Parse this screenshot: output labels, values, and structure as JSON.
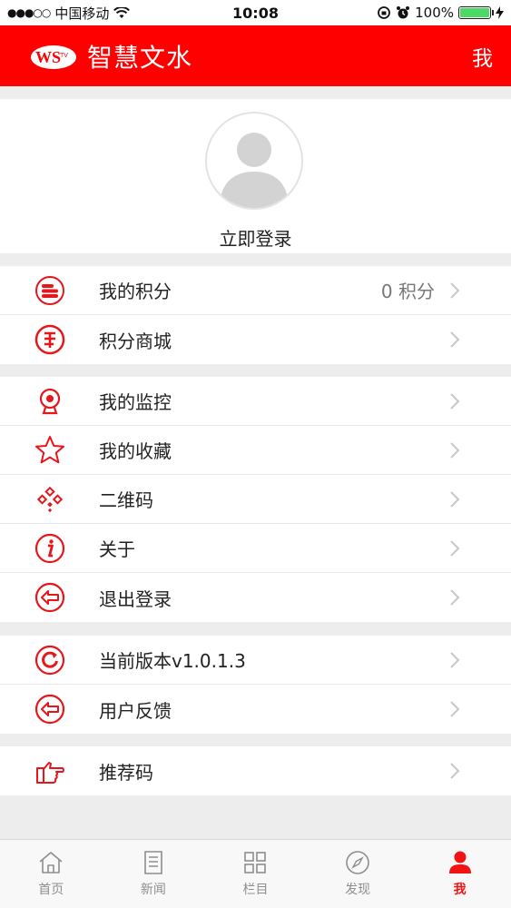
{
  "status_bar": {
    "carrier": "中国移动",
    "time": "10:08",
    "battery": "100%",
    "battery_level": 1.0
  },
  "header": {
    "title": "智慧文水",
    "right": "我",
    "logo_text": "WS TV"
  },
  "profile": {
    "login_label": "立即登录"
  },
  "groups": [
    {
      "items": [
        {
          "label": "我的积分",
          "value": "0 积分",
          "icon": "coins-icon"
        },
        {
          "label": "积分商城",
          "icon": "points-mall-icon"
        }
      ]
    },
    {
      "items": [
        {
          "label": "我的监控",
          "icon": "webcam-icon"
        },
        {
          "label": "我的收藏",
          "icon": "star-icon"
        },
        {
          "label": "二维码",
          "icon": "qr-code-icon"
        },
        {
          "label": "关于",
          "icon": "info-icon"
        },
        {
          "label": "退出登录",
          "icon": "logout-icon"
        }
      ]
    },
    {
      "items": [
        {
          "label": "当前版本v1.0.1.3",
          "icon": "refresh-icon"
        },
        {
          "label": "用户反馈",
          "icon": "feedback-icon"
        }
      ]
    },
    {
      "items": [
        {
          "label": "推荐码",
          "icon": "pointing-hand-icon"
        }
      ]
    }
  ],
  "tabbar": [
    {
      "label": "首页",
      "icon": "home-icon",
      "active": false
    },
    {
      "label": "新闻",
      "icon": "news-icon",
      "active": false
    },
    {
      "label": "栏目",
      "icon": "grid-icon",
      "active": false
    },
    {
      "label": "发现",
      "icon": "compass-icon",
      "active": false
    },
    {
      "label": "我",
      "icon": "person-icon",
      "active": true
    }
  ],
  "colors": {
    "brand_red": "#fe0000",
    "icon_red": "#e8161b",
    "background": "#ededed",
    "tab_inactive": "#8e8e8e",
    "tab_active": "#f21313"
  }
}
